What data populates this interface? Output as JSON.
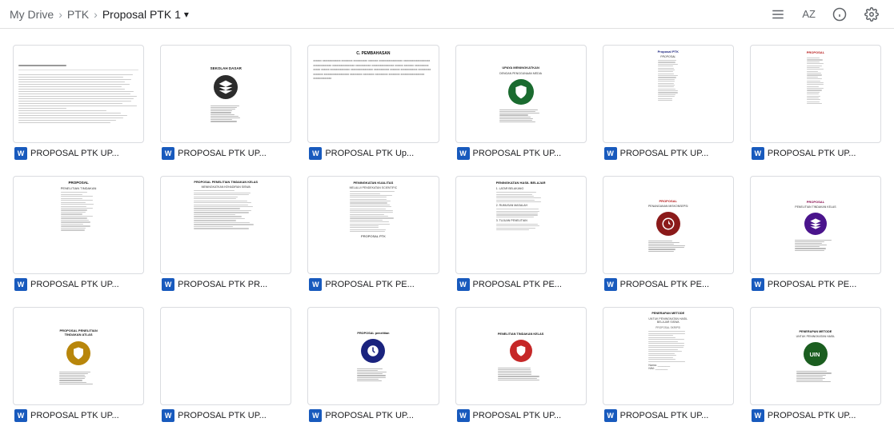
{
  "header": {
    "breadcrumb": {
      "root": "My Drive",
      "sep1": "›",
      "folder": "PTK",
      "sep2": "›",
      "current": "Proposal PTK 1"
    },
    "dropdown_icon": "▾",
    "actions": {
      "list_view_label": "list-view",
      "sort_label": "AZ",
      "info_label": "info",
      "settings_label": "settings"
    }
  },
  "grid": {
    "files": [
      {
        "id": 1,
        "name": "PROPOSAL PTK UP...",
        "thumb_type": "text_lines",
        "has_logo": false
      },
      {
        "id": 2,
        "name": "PROPOSAL PTK UP...",
        "thumb_type": "logo_center",
        "logo_color": "dark",
        "has_logo": true
      },
      {
        "id": 3,
        "name": "PROPOSAL PTK Up...",
        "thumb_type": "text_dense",
        "has_logo": false
      },
      {
        "id": 4,
        "name": "PROPOSAL PTK UP...",
        "thumb_type": "logo_green",
        "has_logo": true
      },
      {
        "id": 5,
        "name": "PROPOSAL PTK UP...",
        "thumb_type": "text_header_blue",
        "has_logo": false
      },
      {
        "id": 6,
        "name": "PROPOSAL PTK UP...",
        "thumb_type": "text_only_header",
        "has_logo": false
      },
      {
        "id": 7,
        "name": "PROPOSAL PTK UP...",
        "thumb_type": "text_proposal",
        "has_logo": false
      },
      {
        "id": 8,
        "name": "PROPOSAL PTK PR...",
        "thumb_type": "text_proposal2",
        "has_logo": false
      },
      {
        "id": 9,
        "name": "PROPOSAL PTK PE...",
        "thumb_type": "text_long",
        "has_logo": false
      },
      {
        "id": 10,
        "name": "PROPOSAL PTK PE...",
        "thumb_type": "text_numbered",
        "has_logo": false
      },
      {
        "id": 11,
        "name": "PROPOSAL PTK PE...",
        "thumb_type": "logo_red",
        "has_logo": true
      },
      {
        "id": 12,
        "name": "PROPOSAL PTK PE...",
        "thumb_type": "logo_maroon",
        "has_logo": true
      },
      {
        "id": 13,
        "name": "PROPOSAL PTK UP...",
        "thumb_type": "logo_gold",
        "has_logo": true
      },
      {
        "id": 14,
        "name": "PROPOSAL PTK UP...",
        "thumb_type": "text_minimal",
        "has_logo": false
      },
      {
        "id": 15,
        "name": "PROPOSAL PTK UP...",
        "thumb_type": "logo_blue_center",
        "has_logo": true
      },
      {
        "id": 16,
        "name": "PROPOSAL PTK UP...",
        "thumb_type": "logo_emblem",
        "has_logo": true
      },
      {
        "id": 17,
        "name": "PROPOSAL PTK UP...",
        "thumb_type": "text_skripsi",
        "has_logo": false
      },
      {
        "id": 18,
        "name": "PROPOSAL PTK UP...",
        "thumb_type": "logo_uin",
        "has_logo": true
      }
    ]
  }
}
